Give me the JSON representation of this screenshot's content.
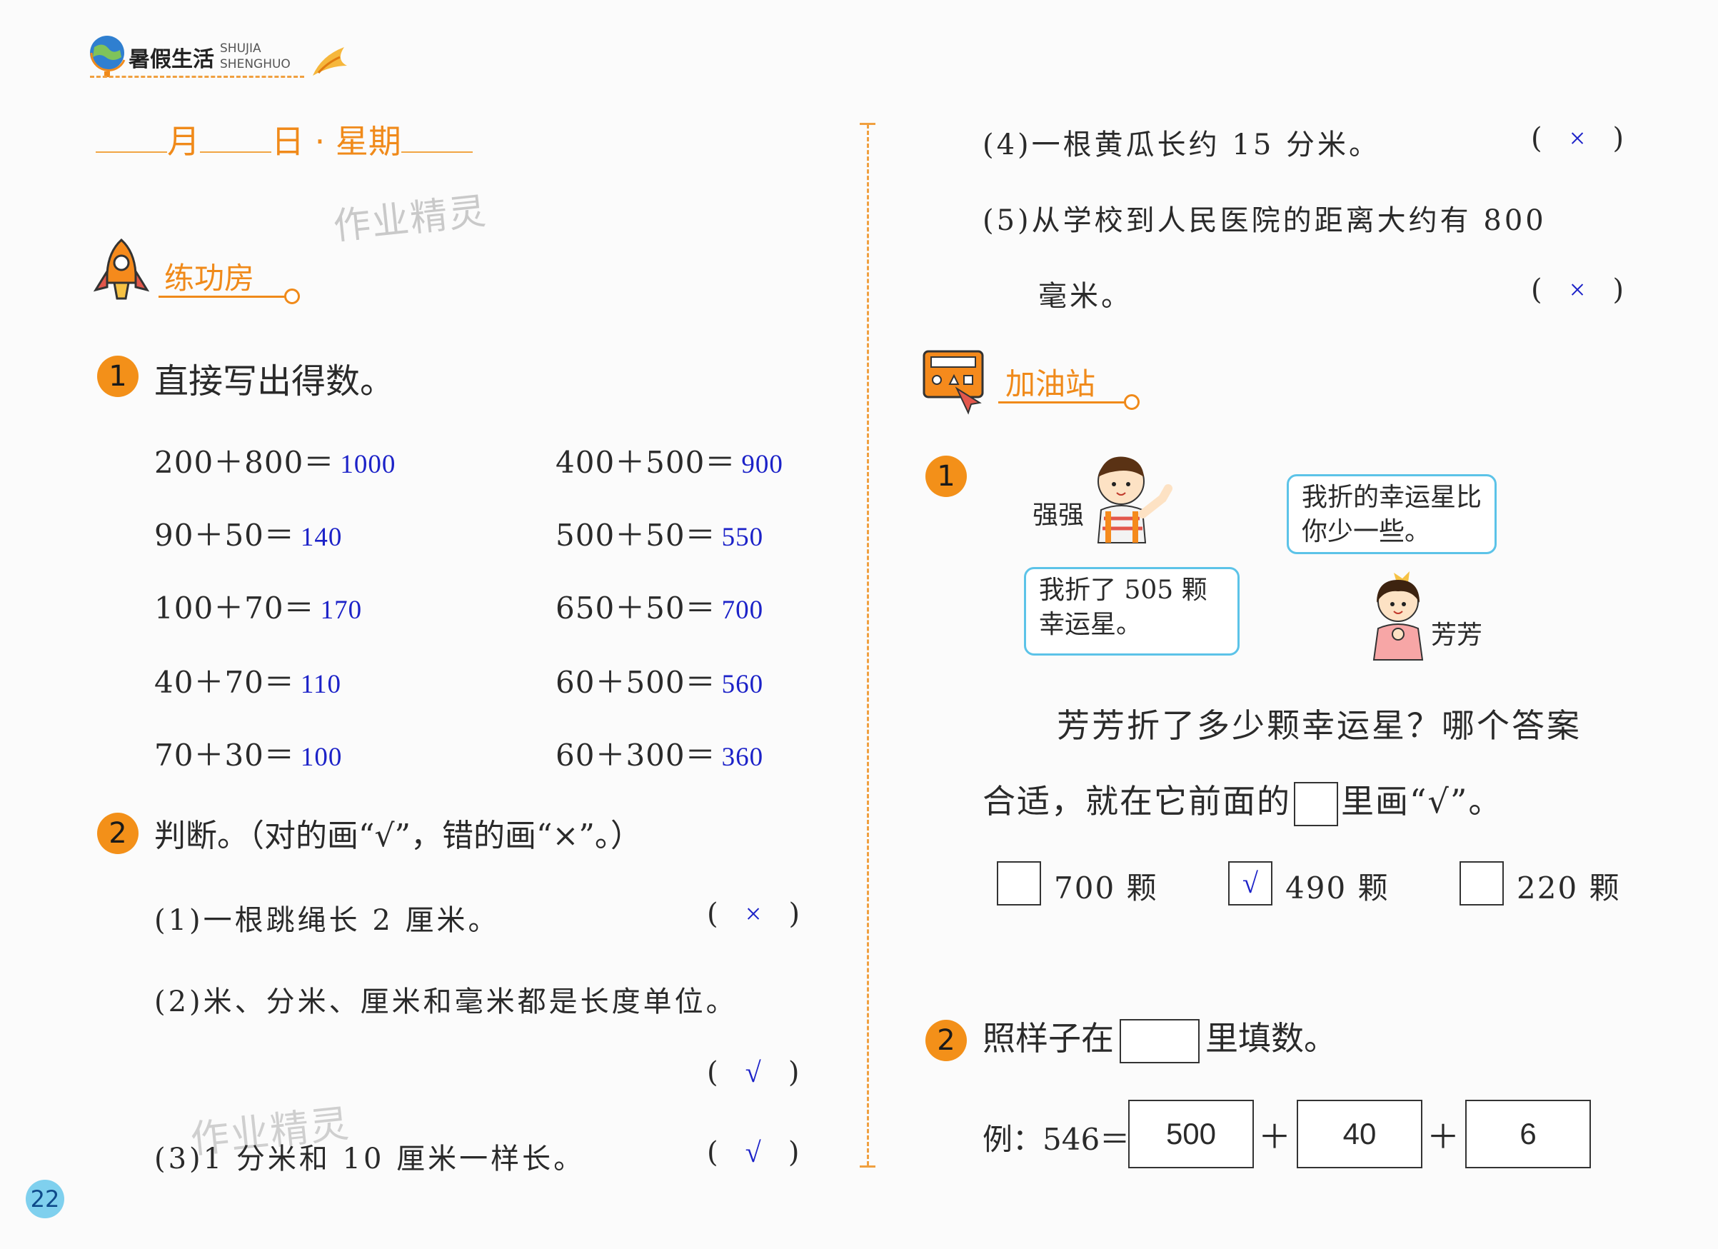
{
  "header": {
    "title_cn": "暑假生活",
    "title_en1": "SHUJIA",
    "title_en2": "SHENGHUO"
  },
  "date_line": {
    "month": "月",
    "day": "日 · 星期"
  },
  "watermark": "作业精灵",
  "page_number": "22",
  "left": {
    "section_title": "练功房",
    "q1": {
      "num": "1",
      "prompt": "直接写出得数。",
      "items": [
        {
          "expr": "200＋800＝",
          "ans": "1000"
        },
        {
          "expr": "400＋500＝",
          "ans": "900"
        },
        {
          "expr": "90＋50＝",
          "ans": "140"
        },
        {
          "expr": "500＋50＝",
          "ans": "550"
        },
        {
          "expr": "100＋70＝",
          "ans": "170"
        },
        {
          "expr": "650＋50＝",
          "ans": "700"
        },
        {
          "expr": "40＋70＝",
          "ans": "110"
        },
        {
          "expr": "60＋500＝",
          "ans": "560"
        },
        {
          "expr": "70＋30＝",
          "ans": "100"
        },
        {
          "expr": "60＋300＝",
          "ans": "360"
        }
      ]
    },
    "q2": {
      "num": "2",
      "prompt": "判断。（对的画“√”，错的画“×”。）",
      "s1": "(1)一根跳绳长 2 厘米。",
      "s1_ans": "×",
      "s2": "(2)米、分米、厘米和毫米都是长度单位。",
      "s2_ans": "√",
      "s3": "(3)1 分米和 10 厘米一样长。",
      "s3_ans": "√"
    }
  },
  "right": {
    "s4": "(4)一根黄瓜长约 15 分米。",
    "s4_ans": "×",
    "s5a": "(5)从学校到人民医院的距离大约有 800",
    "s5b": "毫米。",
    "s5_ans": "×",
    "section_title": "加油站",
    "q1": {
      "num": "1",
      "boy_name": "强强",
      "boy_say": "我折了 505 颗幸运星。",
      "girl_name": "芳芳",
      "girl_say": "我折的幸运星比你少一些。",
      "prompt1": "芳芳折了多少颗幸运星？哪个答案",
      "prompt2a": "合适，就在它前面的",
      "prompt2b": "里画“√”。",
      "options": [
        {
          "label": "700 颗",
          "mark": ""
        },
        {
          "label": "490 颗",
          "mark": "√"
        },
        {
          "label": "220 颗",
          "mark": ""
        }
      ]
    },
    "q2": {
      "num": "2",
      "prompt_a": "照样子在",
      "prompt_b": "里填数。",
      "example_label": "例：546＝",
      "plus": "＋",
      "parts": [
        "500",
        "40",
        "6"
      ]
    }
  }
}
